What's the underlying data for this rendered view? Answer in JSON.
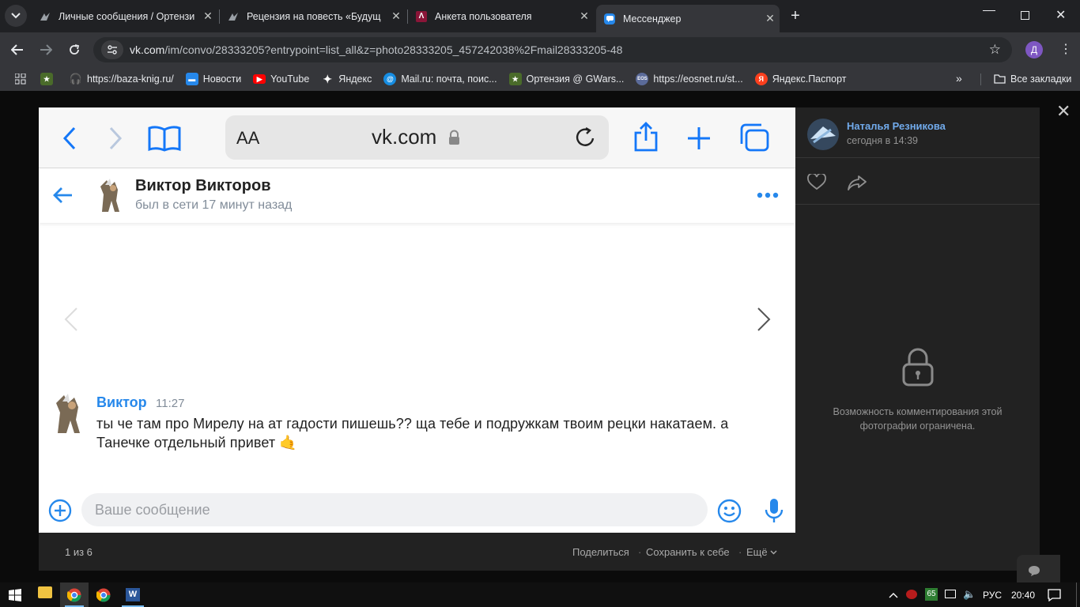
{
  "browser": {
    "tabs": [
      {
        "title": "Личные сообщения / Ортензи",
        "icon": "gwars-icon"
      },
      {
        "title": "Рецензия на повесть «Будущ",
        "icon": "gwars-icon"
      },
      {
        "title": "Анкета пользователя",
        "icon": "ankets-icon"
      },
      {
        "title": "Мессенджер",
        "icon": "vk-messenger-icon"
      }
    ],
    "url_host": "vk.com",
    "url_path": "/im/convo/28333205?entrypoint=list_all&z=photo28333205_457242038%2Fmail28333205-48",
    "profile_letter": "Д",
    "bookmarks": [
      {
        "label": "",
        "icon": "star-green-icon"
      },
      {
        "label": "https://baza-knig.ru/",
        "icon": "headphones-icon"
      },
      {
        "label": "Новости",
        "icon": "vk-news-icon"
      },
      {
        "label": "YouTube",
        "icon": "youtube-icon"
      },
      {
        "label": "Яндекс",
        "icon": "yandex-star-icon"
      },
      {
        "label": "Mail.ru: почта, поис...",
        "icon": "mail-at-icon"
      },
      {
        "label": "Ортензия @ GWars...",
        "icon": "gwars-icon"
      },
      {
        "label": "https://eosnet.ru/st...",
        "icon": "eos-icon"
      },
      {
        "label": "Яндекс.Паспорт",
        "icon": "yandex-passport-icon"
      }
    ],
    "all_bookmarks": "Все закладки"
  },
  "photo": {
    "safari_aa": "AA",
    "safari_host": "vk.com",
    "chat_name": "Виктор Викторов",
    "chat_status": "был в сети 17 минут назад",
    "message": {
      "author": "Виктор",
      "time": "11:27",
      "line1": "ты че там про Мирелу на ат гадости пишешь?? ща тебе и подружкам твоим рецки накатаем. а",
      "line2": "Танечке отдельный привет 🤙"
    },
    "input_placeholder": "Ваше сообщение"
  },
  "viewer": {
    "counter": "1 из 6",
    "share": "Поделиться",
    "save": "Сохранить к себе",
    "more": "Ещё",
    "author_name": "Наталья Резникова",
    "author_date": "сегодня в 14:39",
    "comments_closed": "Возможность комментирования этой фотографии ограничена."
  },
  "taskbar": {
    "lang": "РУС",
    "time": "20:40",
    "battery": "65"
  },
  "colors": {
    "vk_blue": "#2688eb",
    "safari_blue": "#1477f8",
    "chrome_dark": "#202124"
  }
}
